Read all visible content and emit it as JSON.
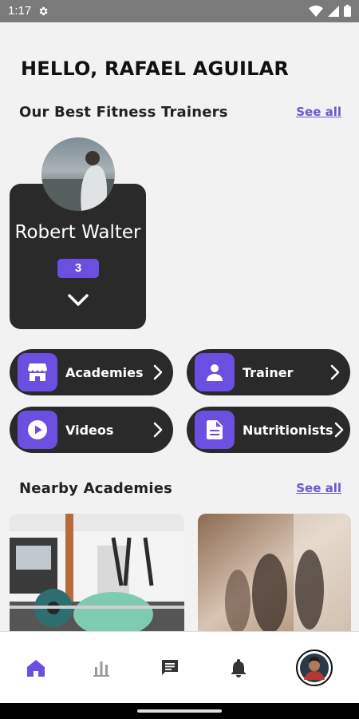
{
  "status": {
    "time": "1:17"
  },
  "greeting": "HELLO, RAFAEL AGUILAR",
  "trainers_section": {
    "title": "Our Best Fitness Trainers",
    "see_all": "See all"
  },
  "trainer": {
    "name": "Robert Walter",
    "count": "3"
  },
  "categories": [
    {
      "label": "Academies",
      "icon": "storefront-icon"
    },
    {
      "label": "Trainer",
      "icon": "person-icon"
    },
    {
      "label": "Videos",
      "icon": "play-circle-icon"
    },
    {
      "label": "Nutritionists",
      "icon": "document-icon"
    }
  ],
  "academies_section": {
    "title": "Nearby Academies",
    "see_all": "See all"
  },
  "nav": {
    "items": [
      "home-icon",
      "chart-icon",
      "chat-icon",
      "bell-icon",
      "profile-avatar"
    ],
    "active": "home-icon"
  },
  "colors": {
    "accent": "#6a4fe0",
    "dark_card": "#2a2a2a",
    "link": "#6a5acd",
    "background": "#f2f2f2"
  }
}
